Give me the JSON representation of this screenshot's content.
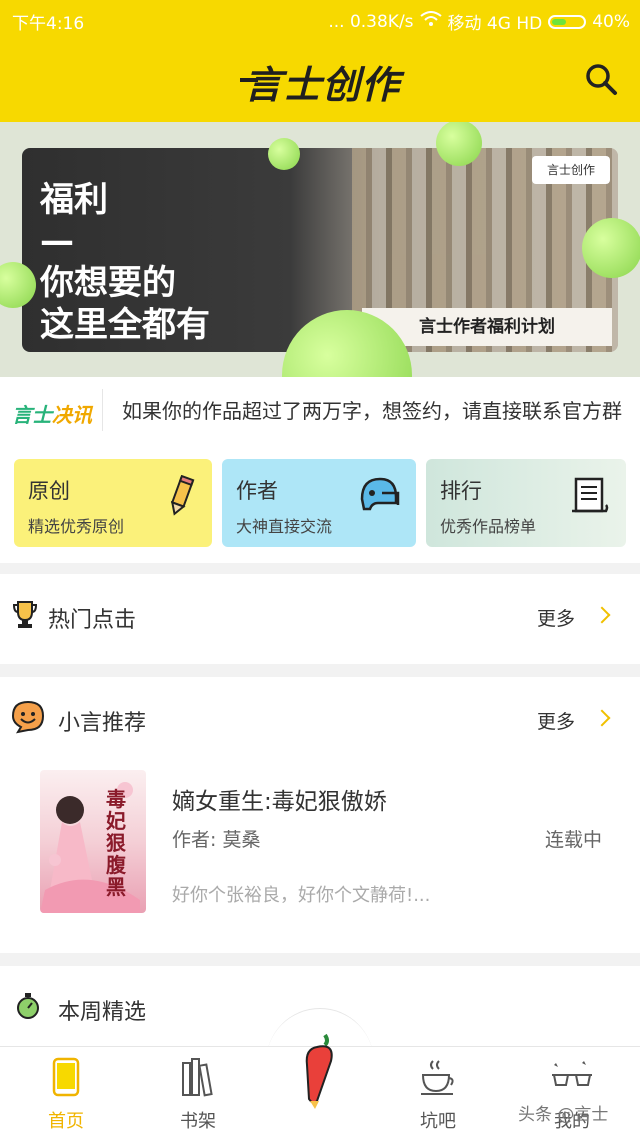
{
  "status_bar": {
    "time": "下午4:16",
    "net": "... 0.38K/s",
    "carrier": "移动 4G HD",
    "battery": "40%"
  },
  "header": {
    "brand": "言士创作"
  },
  "banner": {
    "headline": "福利",
    "dash": "—",
    "line1": "你想要的",
    "line2": "这里全都有",
    "plan": "言士作者福利计划",
    "logo": "言士创作"
  },
  "news": {
    "tag_a": "言士",
    "tag_b": "决讯",
    "text": "如果你的作品超过了两万字，想签约，请直接联系官方群"
  },
  "categories": [
    {
      "title": "原创",
      "subtitle": "精选优秀原创"
    },
    {
      "title": "作者",
      "subtitle": "大神直接交流"
    },
    {
      "title": "排行",
      "subtitle": "优秀作品榜单"
    }
  ],
  "hot": {
    "title": "热门点击",
    "more": "更多"
  },
  "recommend": {
    "title": "小言推荐",
    "more": "更多",
    "book": {
      "title": "嫡女重生:毒妃狠傲娇",
      "author": "作者: 莫桑",
      "status": "连载中",
      "desc": "好你个张裕良，好你个文静荷!...",
      "cover_text": "毒妃狠腹黑"
    }
  },
  "weekly": {
    "title": "本周精选"
  },
  "tabs": [
    {
      "label": "首页"
    },
    {
      "label": "书架"
    },
    {
      "label": "坑吧"
    },
    {
      "label": "我的"
    }
  ],
  "watermark": "头条 @言士"
}
